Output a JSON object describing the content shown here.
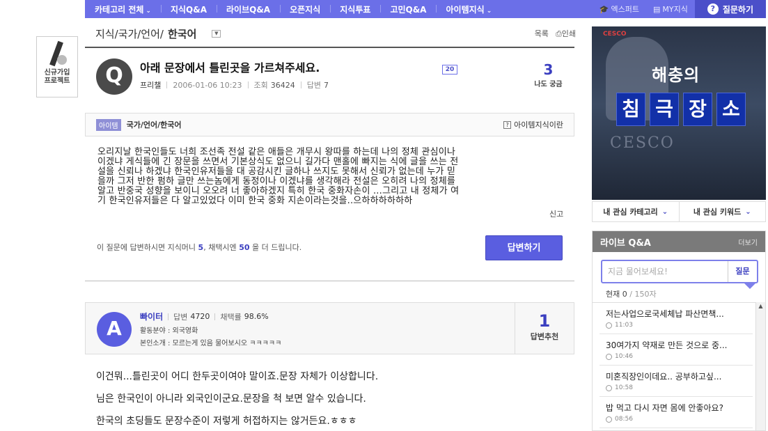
{
  "nav": {
    "items": [
      {
        "label": "카테고리 전체",
        "caret": true
      },
      {
        "label": "지식Q&A",
        "caret": false
      },
      {
        "label": "라이브Q&A",
        "caret": false
      },
      {
        "label": "오픈지식",
        "caret": false
      },
      {
        "label": "지식투표",
        "caret": false
      },
      {
        "label": "고민Q&A",
        "caret": false
      },
      {
        "label": "아이템지식",
        "caret": true
      }
    ],
    "expert": "엑스퍼트",
    "my": "MY지식",
    "ask": "질문하기"
  },
  "left_banner": {
    "line1": "신규가입",
    "line2": "프로젝트"
  },
  "breadcrumb": {
    "path": "지식/국가/언어/",
    "current": "한국어",
    "list": "목록",
    "print": "인쇄"
  },
  "question": {
    "icon": "Q",
    "title": "아래 문장에서 틀린곳을 가르쳐주세요.",
    "author": "프리챌",
    "date": "2006-01-06 10:23",
    "views_label": "조회",
    "views": "36424",
    "answers_label": "답변",
    "answers": "7",
    "badge": "20",
    "metoo_count": "3",
    "metoo_label": "나도 궁금",
    "body": [
      "오리지날 한국인들도 너희 조선족 전설 같은 애들은 개무시 왕따를 하는데 나의 정체 관심이나",
      "이겠냐 게식들에 긴 장문을 쓰면서 기본상식도 없으니 길가다 맨홀에 빠지는 식에 글을 쓰는 전",
      "설을 신뢰나 하겠냐 한국인유저들을 대 공감시킨 글하나 쓰지도 못해서 신뢰가 없는데 누가 믿",
      "을까 그저 반한 펌하 글만 쓰는놈에게 동정이나 이겠냐를 생각해라 전설은 오히려 나의 정체를",
      "알고 반중국 성향을 보이니 오오려 너 좋아하겠지 특히 한국 중화자손이 ...그리고 내 정체가 여",
      "기 한국인유저들은 다 알고있었다  이미 한국 중화 지손이라는것을..으하하하하하하"
    ],
    "report": "신고",
    "reward_pre": "이 질문에 답변하시면 지식머니 ",
    "reward_money": "5",
    "reward_mid": ", 채택시엔 ",
    "reward_bonus": "50",
    "reward_post": " 을 더 드립니다.",
    "answer_button": "답변하기"
  },
  "tags": {
    "tag": "아이템",
    "path": "국가/언어/한국어",
    "help": "아이템지식이란"
  },
  "answer": {
    "icon": "A",
    "name": "빠이터",
    "answers_label": "답변",
    "answers": "4720",
    "rate_label": "채택률",
    "rate": "98.6%",
    "field": "활동분야 : 외국영화",
    "intro": "본인소개 : 모르는게 있음 물어보시오 ㅋㅋㅋㅋㅋ",
    "rec_count": "1",
    "rec_label": "답변추천",
    "body": [
      "이건뭐...틀린곳이 어디 한두곳이여야 말이죠.문장 자체가 이상합니다.",
      "님은 한국인이 아니라 외국인이군요.문장을 척 보면 알수 있습니다.",
      "한국의 초딩들도 문장수준이 저렇게 허접하지는 않거든요.ㅎㅎㅎ"
    ]
  },
  "ad": {
    "brand": "CESCO",
    "headline": "해충의",
    "tiles": [
      "침",
      "극",
      "장",
      "소"
    ],
    "logo": "CESCO"
  },
  "interest": {
    "category": "내 관심 카테고리",
    "keyword": "내 관심 키워드"
  },
  "live_qa": {
    "title": "라이브 Q&A",
    "more": "더보기",
    "placeholder": "지금 물어보세요!",
    "ask": "질문",
    "count_prefix": "현재 ",
    "count": "0",
    "count_suffix": " / 150자",
    "items": [
      {
        "q": "저는사업으로국세체납 파산면책...",
        "time": "11:03"
      },
      {
        "q": "30여가지 약재로 만든 것으로 중...",
        "time": "10:46"
      },
      {
        "q": "미혼직장인이데요.. 공부하고싶...",
        "time": "10:58"
      },
      {
        "q": "밥 먹고 다시 자면 몸에 안좋아요?",
        "time": "08:56"
      }
    ]
  }
}
